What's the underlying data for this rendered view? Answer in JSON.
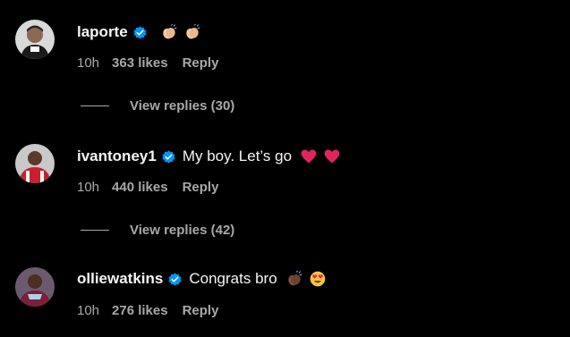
{
  "comments": [
    {
      "username": "laporte",
      "text": "",
      "emojis": [
        "clapping-hands-light",
        "clapping-hands-light"
      ],
      "time": "10h",
      "likes": "363 likes",
      "reply_label": "Reply",
      "view_replies": "View replies (30)"
    },
    {
      "username": "ivantoney1",
      "text": "My boy. Let’s go",
      "emojis": [
        "red-heart",
        "red-heart"
      ],
      "time": "10h",
      "likes": "440 likes",
      "reply_label": "Reply",
      "view_replies": "View replies (42)"
    },
    {
      "username": "olliewatkins",
      "text": "Congrats bro",
      "emojis": [
        "clapping-hands-dark",
        "heart-eyes-face"
      ],
      "time": "10h",
      "likes": "276 likes",
      "reply_label": "Reply"
    }
  ],
  "colors": {
    "background": "#000000",
    "primary_text": "#f5f5f5",
    "secondary_text": "#a8a8a8",
    "verified_badge": "#0095f6",
    "heart": "#e0245e"
  }
}
